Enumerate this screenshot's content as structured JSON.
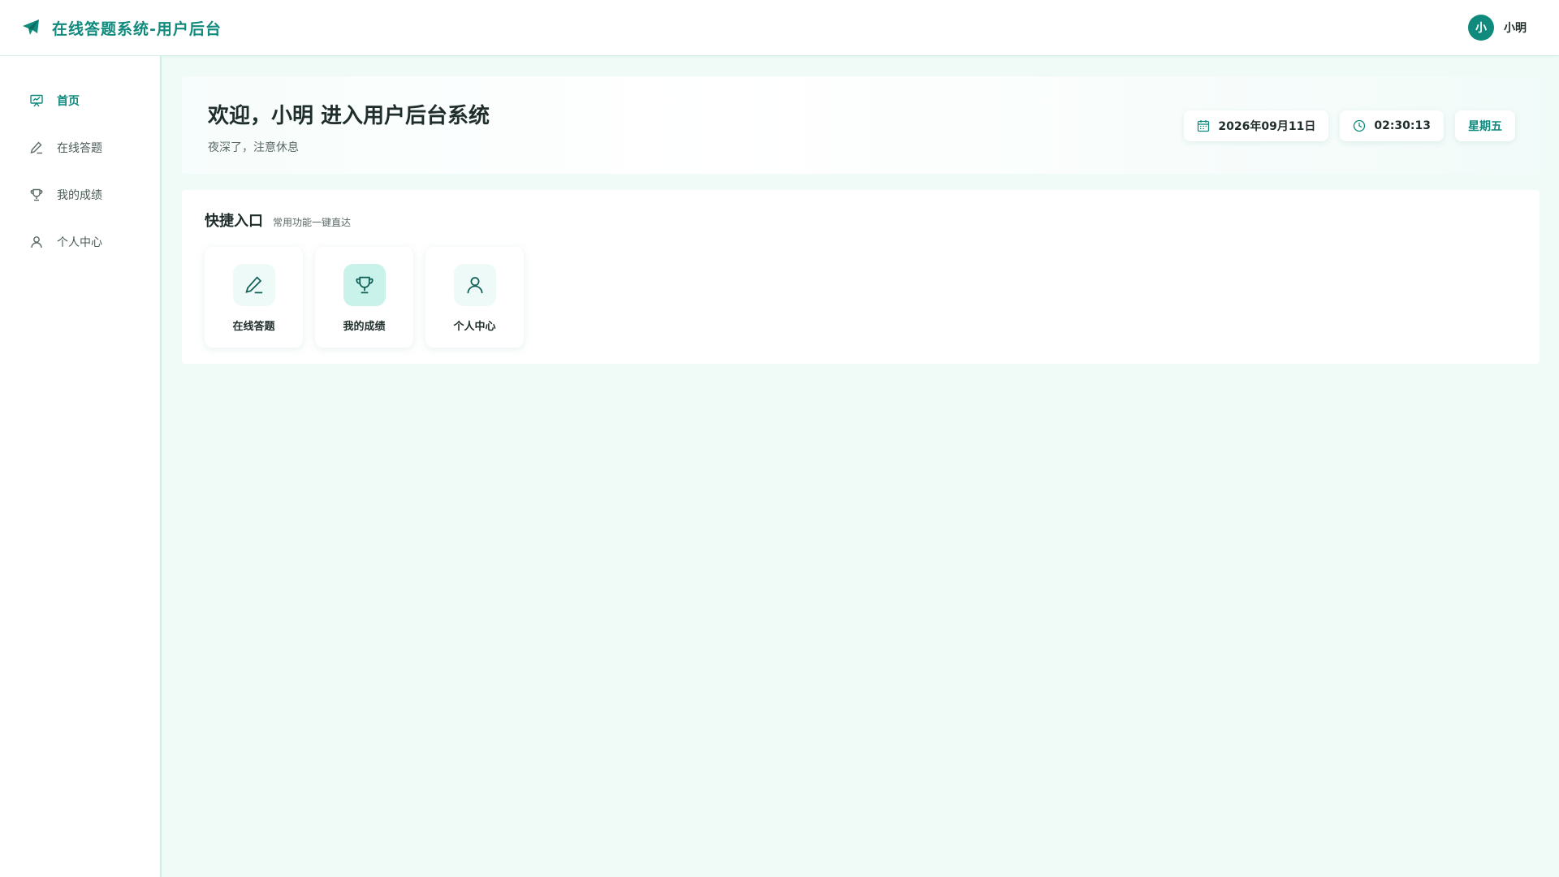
{
  "header": {
    "title": "在线答题系统-用户后台",
    "brand_icon": "paper-plane-icon",
    "user": {
      "avatar_text": "小",
      "name": "小明"
    }
  },
  "sidebar": {
    "items": [
      {
        "label": "首页",
        "icon": "presentation-icon",
        "active": true
      },
      {
        "label": "在线答题",
        "icon": "pen-icon",
        "active": false
      },
      {
        "label": "我的成绩",
        "icon": "trophy-icon",
        "active": false
      },
      {
        "label": "个人中心",
        "icon": "user-icon",
        "active": false
      }
    ]
  },
  "welcome": {
    "title": "欢迎，小明 进入用户后台系统",
    "subtitle": "夜深了，注意休息",
    "date": "2026年09月11日",
    "time": "02:30:13",
    "weekday": "星期五"
  },
  "quick": {
    "title": "快捷入口",
    "subtitle": "常用功能一键直达",
    "tiles": [
      {
        "label": "在线答题",
        "icon": "pen-icon"
      },
      {
        "label": "我的成绩",
        "icon": "trophy-icon"
      },
      {
        "label": "个人中心",
        "icon": "user-icon"
      }
    ]
  },
  "colors": {
    "accent": "#0f8a7d",
    "background": "#f0fbf8",
    "surface": "#ffffff"
  }
}
